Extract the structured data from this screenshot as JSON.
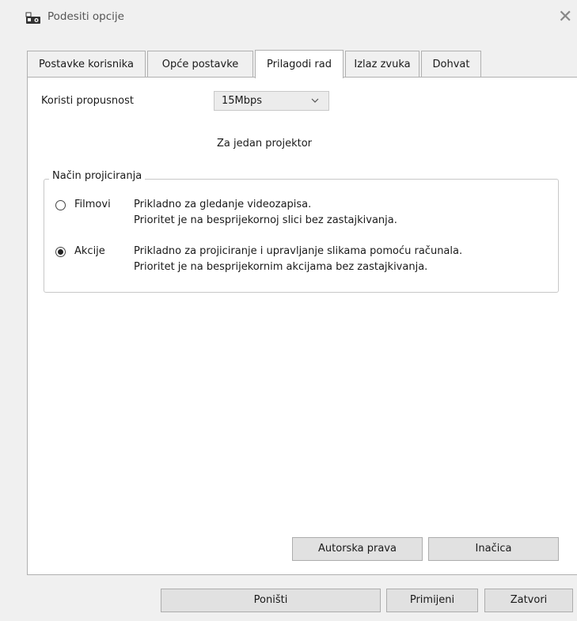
{
  "window": {
    "title": "Podesiti opcije",
    "icon": "projector-app-icon",
    "close_glyph": "✕"
  },
  "tabs": [
    {
      "label": "Postavke korisnika",
      "active": false
    },
    {
      "label": "Opće postavke",
      "active": false
    },
    {
      "label": "Prilagodi rad",
      "active": true
    },
    {
      "label": "Izlaz zvuka",
      "active": false
    },
    {
      "label": "Dohvat",
      "active": false
    }
  ],
  "bandwidth": {
    "label": "Koristi propusnost",
    "value": "15Mbps",
    "note": "Za jedan projektor"
  },
  "projection_mode": {
    "legend": "Način projiciranja",
    "options": [
      {
        "label": "Filmovi",
        "selected": false,
        "line1": "Prikladno za gledanje videozapisa.",
        "line2": "Prioritet je na besprijekornoj slici bez zastajkivanja."
      },
      {
        "label": "Akcije",
        "selected": true,
        "line1": "Prikladno za projiciranje i upravljanje slikama pomoću računala.",
        "line2": "Prioritet je na besprijekornim akcijama bez zastajkivanja."
      }
    ]
  },
  "panel_buttons": {
    "copyright": "Autorska prava",
    "version": "Inačica"
  },
  "footer_buttons": {
    "cancel": "Poništi",
    "apply": "Primijeni",
    "close": "Zatvori"
  },
  "colors": {
    "window_bg": "#f0f0f0",
    "panel_bg": "#ffffff",
    "button_bg": "#e1e1e1",
    "border": "#adadad"
  }
}
